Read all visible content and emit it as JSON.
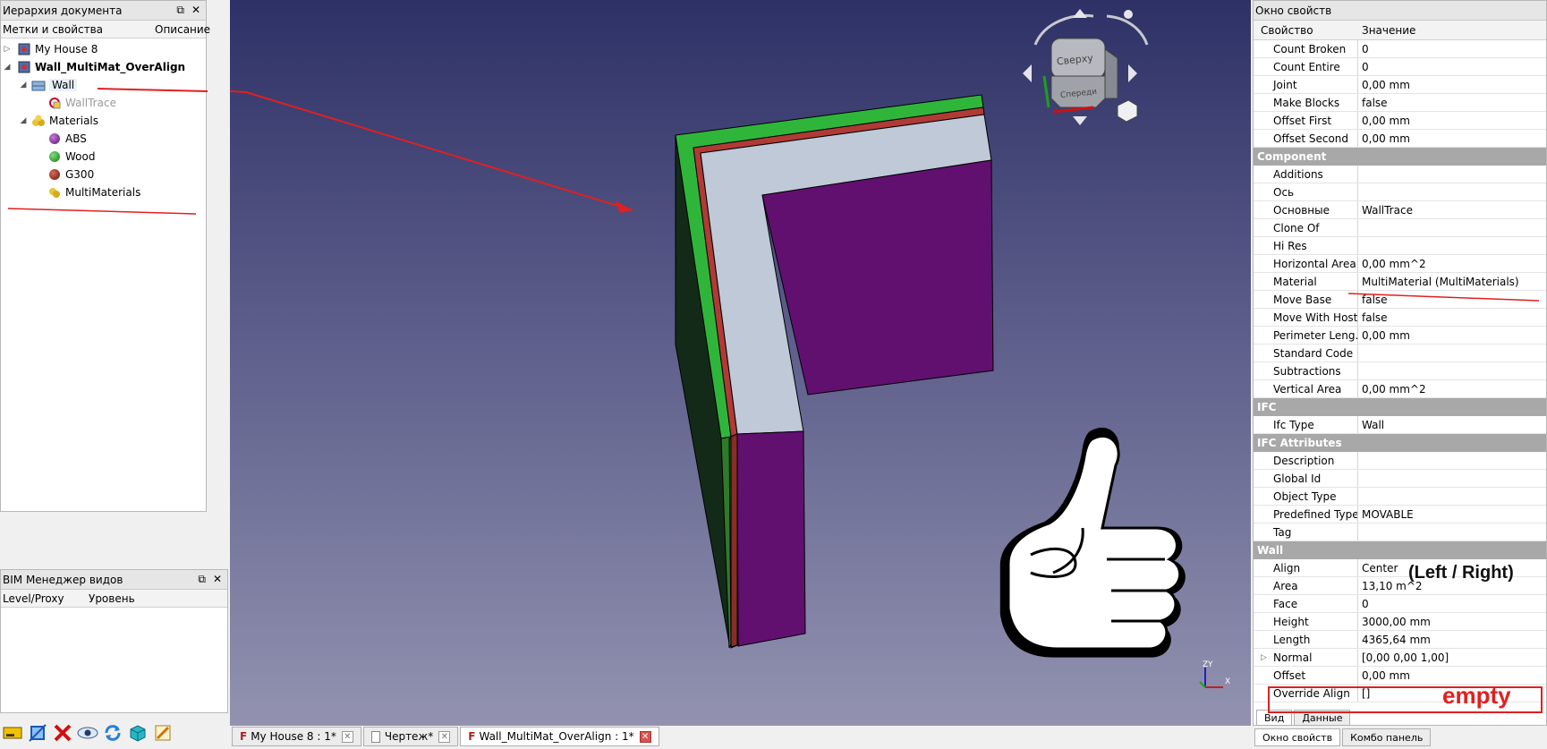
{
  "tree_panel": {
    "title": "Иерархия документа",
    "col_labels": "Метки и свойства",
    "col_desc": "Описание",
    "items": [
      {
        "label": "My House 8"
      },
      {
        "label": "Wall_MultiMat_OverAlign"
      },
      {
        "label": "Wall"
      },
      {
        "label": "WallTrace"
      },
      {
        "label": "Materials"
      },
      {
        "label": "ABS"
      },
      {
        "label": "Wood"
      },
      {
        "label": "G300"
      },
      {
        "label": "MultiMaterials"
      }
    ]
  },
  "bim_panel": {
    "title": "BIM Менеджер видов",
    "col_level": "Level/Proxy",
    "col_value": "Уровень"
  },
  "navcube": {
    "top": "Сверху",
    "front": "Спереди"
  },
  "axis": {
    "z": "Z",
    "y": "Y",
    "x": "X"
  },
  "doc_tabs": [
    {
      "label": "My House 8 : 1*"
    },
    {
      "label": "Чертеж*"
    },
    {
      "label": "Wall_MultiMat_OverAlign : 1*"
    }
  ],
  "props": {
    "title": "Окно свойств",
    "col_prop": "Свойство",
    "col_value": "Значение",
    "rows_top": [
      {
        "k": "Count Broken",
        "v": "0"
      },
      {
        "k": "Count Entire",
        "v": "0"
      },
      {
        "k": "Joint",
        "v": "0,00 mm"
      },
      {
        "k": "Make Blocks",
        "v": "false"
      },
      {
        "k": "Offset First",
        "v": "0,00 mm"
      },
      {
        "k": "Offset Second",
        "v": "0,00 mm"
      }
    ],
    "group_component": "Component",
    "rows_component": [
      {
        "k": "Additions",
        "v": ""
      },
      {
        "k": "Ось",
        "v": ""
      },
      {
        "k": "Основные",
        "v": "WallTrace"
      },
      {
        "k": "Clone Of",
        "v": ""
      },
      {
        "k": "Hi Res",
        "v": ""
      },
      {
        "k": "Horizontal Area",
        "v": "0,00 mm^2"
      },
      {
        "k": "Material",
        "v": "MultiMaterial (MultiMaterials)"
      },
      {
        "k": "Move Base",
        "v": "false"
      },
      {
        "k": "Move With Host",
        "v": "false"
      },
      {
        "k": "Perimeter Leng...",
        "v": "0,00 mm"
      },
      {
        "k": "Standard Code",
        "v": ""
      },
      {
        "k": "Subtractions",
        "v": ""
      },
      {
        "k": "Vertical Area",
        "v": "0,00 mm^2"
      }
    ],
    "group_ifc": "IFC",
    "rows_ifc": [
      {
        "k": "Ifc Type",
        "v": "Wall"
      }
    ],
    "group_ifc_attr": "IFC Attributes",
    "rows_ifc_attr": [
      {
        "k": "Description",
        "v": ""
      },
      {
        "k": "Global Id",
        "v": ""
      },
      {
        "k": "Object Type",
        "v": ""
      },
      {
        "k": "Predefined Type",
        "v": "MOVABLE"
      },
      {
        "k": "Tag",
        "v": ""
      }
    ],
    "group_wall": "Wall",
    "rows_wall": [
      {
        "k": "Align",
        "v": "Center"
      },
      {
        "k": "Area",
        "v": "13,10 m^2"
      },
      {
        "k": "Face",
        "v": "0"
      },
      {
        "k": "Height",
        "v": "3000,00 mm"
      },
      {
        "k": "Length",
        "v": "4365,64 mm"
      },
      {
        "k": "Normal",
        "v": "[0,00 0,00 1,00]"
      },
      {
        "k": "Offset",
        "v": "0,00 mm"
      },
      {
        "k": "Override Align",
        "v": "[]"
      }
    ],
    "tab_view": "Вид",
    "tab_data": "Данные",
    "bottom_tab_props": "Окно свойств",
    "bottom_tab_combo": "Комбо панель"
  },
  "annotations": {
    "left_right": "(Left / Right)",
    "empty": "empty"
  },
  "colors": {
    "viewport_top": "#2e3166",
    "viewport_bottom": "#8f8fae",
    "wall_green": "#2fb63a",
    "wall_red": "#b03a36",
    "wall_core": "#bfc9d8",
    "wall_purple": "#611070",
    "annotation_red": "#e02020"
  }
}
